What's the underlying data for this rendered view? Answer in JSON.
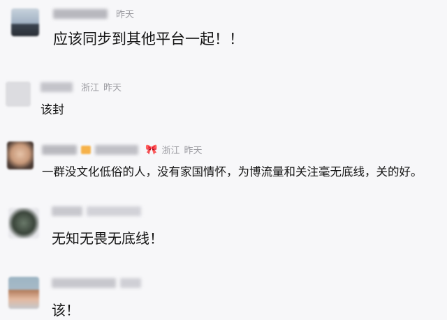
{
  "comments": [
    {
      "location": "",
      "time": "昨天",
      "text": "应该同步到其他平台一起！！"
    },
    {
      "location": "浙江",
      "time": "昨天",
      "text": "该封"
    },
    {
      "location": "浙江",
      "time": "昨天",
      "text": "一群没文化低俗的人，没有家国情怀，为博流量和关注毫无底线，关的好。",
      "badge_icon": "bow-icon"
    },
    {
      "location": "",
      "time": "",
      "text": "无知无畏无底线！"
    },
    {
      "location": "",
      "time": "",
      "text": "该！"
    }
  ],
  "colors": {
    "meta": "#9a9aa0",
    "bow": "#e0305a",
    "background": "#f7f7f9"
  }
}
